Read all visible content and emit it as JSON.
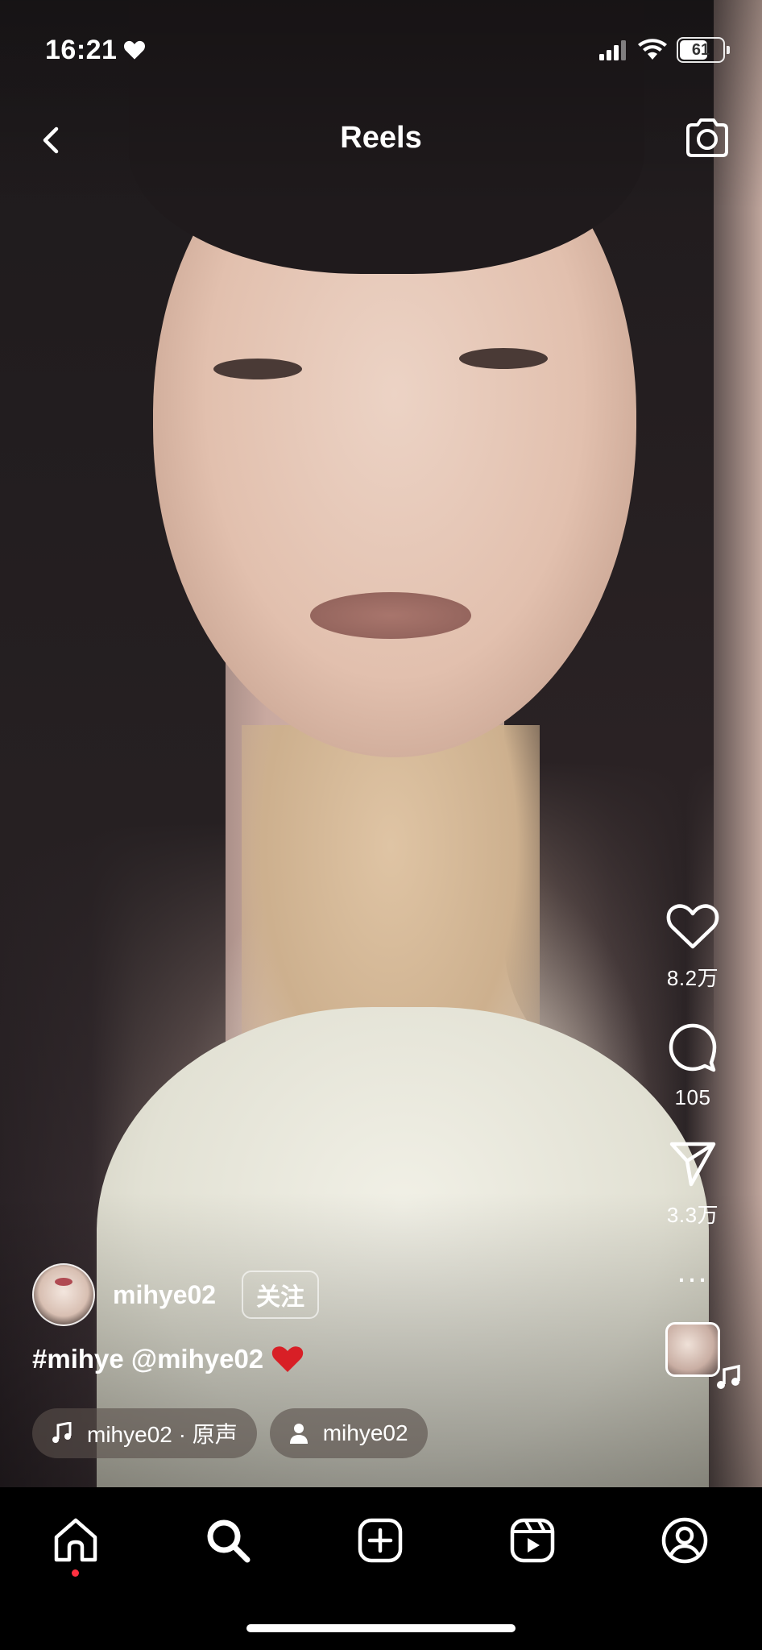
{
  "status_bar": {
    "time": "16:21",
    "battery": "61"
  },
  "header": {
    "title": "Reels"
  },
  "actions": {
    "likes": "8.2万",
    "comments": "105",
    "shares": "3.3万",
    "more": "..."
  },
  "post": {
    "username": "mihye02",
    "follow_label": "关注",
    "caption": "#mihye @mihye02",
    "audio_label": "mihye02 · 原声",
    "tagged_user": "mihye02"
  },
  "colors": {
    "notification_dot": "#ff3040",
    "caption_heart": "#d81f26"
  },
  "tabs": [
    "home-icon",
    "search-icon",
    "create-icon",
    "reels-icon",
    "profile-icon"
  ]
}
